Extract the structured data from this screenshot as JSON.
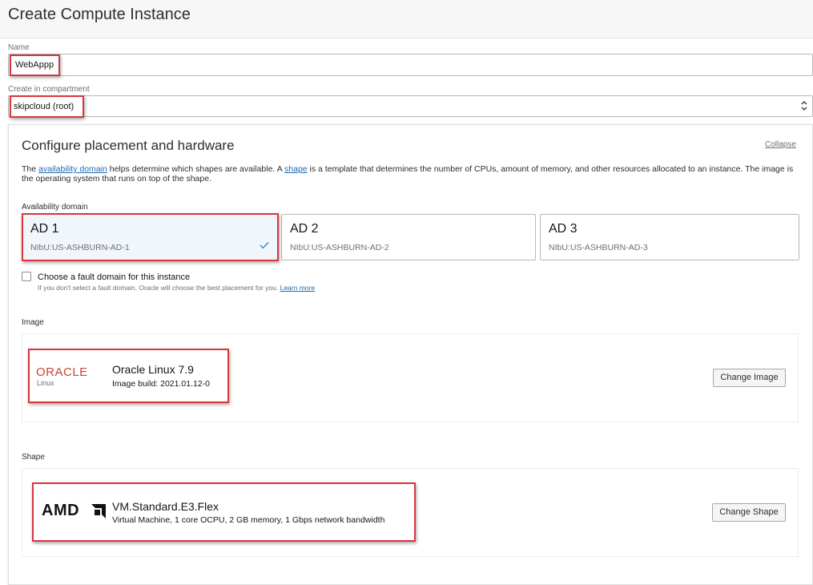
{
  "page": {
    "title": "Create Compute Instance"
  },
  "name_field": {
    "label": "Name",
    "value": "WebAppp"
  },
  "compartment": {
    "label": "Create in compartment",
    "value": "skipcloud (root)",
    "arrows": "⌃⌄"
  },
  "placement": {
    "title": "Configure placement and hardware",
    "collapse_label": "Collapse",
    "desc_1": "The ",
    "desc_link_ad": "availability domain",
    "desc_2": " helps determine which shapes are available. A ",
    "desc_link_shape": "shape",
    "desc_3": " is a template that determines the number of CPUs, amount of memory, and other resources allocated to an instance. The image is the operating system that runs on top of the shape.",
    "ad_label": "Availability domain",
    "ads": [
      {
        "name": "AD 1",
        "value": "NIbU:US-ASHBURN-AD-1",
        "selected": true
      },
      {
        "name": "AD 2",
        "value": "NIbU:US-ASHBURN-AD-2",
        "selected": false
      },
      {
        "name": "AD 3",
        "value": "NIbU:US-ASHBURN-AD-3",
        "selected": false
      }
    ],
    "fault_label": "Choose a fault domain for this instance",
    "fault_hint": "If you don't select a fault domain, Oracle will choose the best placement for you. ",
    "fault_link": "Learn more"
  },
  "image": {
    "section_label": "Image",
    "logo_word": "ORACLE",
    "logo_sub": "Linux",
    "name": "Oracle Linux 7.9",
    "build": "Image build: 2021.01.12-0",
    "button": "Change Image"
  },
  "shape": {
    "section_label": "Shape",
    "logo_word": "AMD",
    "name": "VM.Standard.E3.Flex",
    "desc": "Virtual Machine, 1 core OCPU, 2 GB memory, 1 Gbps network bandwidth",
    "button": "Change Shape"
  },
  "colors": {
    "highlight": "#d9363e",
    "link": "#1f6ab5",
    "oracle_red": "#c74634",
    "check": "#2b7fd0"
  }
}
